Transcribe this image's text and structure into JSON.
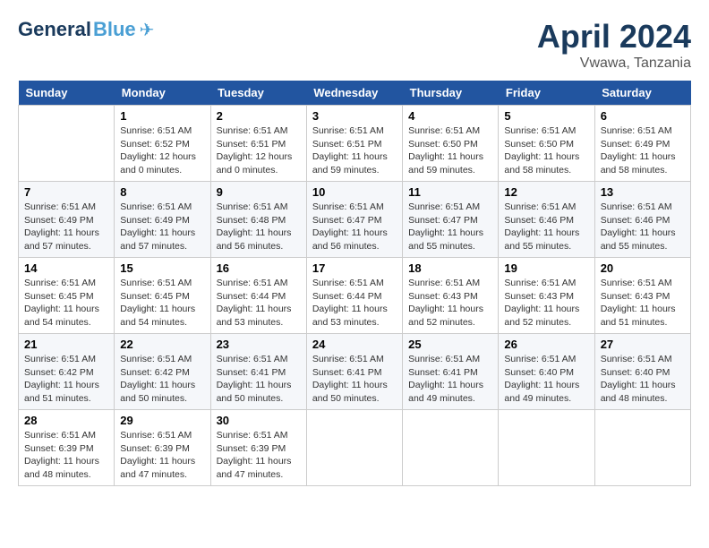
{
  "header": {
    "logo_general": "General",
    "logo_blue": "Blue",
    "month": "April 2024",
    "location": "Vwawa, Tanzania"
  },
  "weekdays": [
    "Sunday",
    "Monday",
    "Tuesday",
    "Wednesday",
    "Thursday",
    "Friday",
    "Saturday"
  ],
  "weeks": [
    [
      {
        "day": "",
        "info": ""
      },
      {
        "day": "1",
        "info": "Sunrise: 6:51 AM\nSunset: 6:52 PM\nDaylight: 12 hours\nand 0 minutes."
      },
      {
        "day": "2",
        "info": "Sunrise: 6:51 AM\nSunset: 6:51 PM\nDaylight: 12 hours\nand 0 minutes."
      },
      {
        "day": "3",
        "info": "Sunrise: 6:51 AM\nSunset: 6:51 PM\nDaylight: 11 hours\nand 59 minutes."
      },
      {
        "day": "4",
        "info": "Sunrise: 6:51 AM\nSunset: 6:50 PM\nDaylight: 11 hours\nand 59 minutes."
      },
      {
        "day": "5",
        "info": "Sunrise: 6:51 AM\nSunset: 6:50 PM\nDaylight: 11 hours\nand 58 minutes."
      },
      {
        "day": "6",
        "info": "Sunrise: 6:51 AM\nSunset: 6:49 PM\nDaylight: 11 hours\nand 58 minutes."
      }
    ],
    [
      {
        "day": "7",
        "info": "Sunrise: 6:51 AM\nSunset: 6:49 PM\nDaylight: 11 hours\nand 57 minutes."
      },
      {
        "day": "8",
        "info": "Sunrise: 6:51 AM\nSunset: 6:49 PM\nDaylight: 11 hours\nand 57 minutes."
      },
      {
        "day": "9",
        "info": "Sunrise: 6:51 AM\nSunset: 6:48 PM\nDaylight: 11 hours\nand 56 minutes."
      },
      {
        "day": "10",
        "info": "Sunrise: 6:51 AM\nSunset: 6:47 PM\nDaylight: 11 hours\nand 56 minutes."
      },
      {
        "day": "11",
        "info": "Sunrise: 6:51 AM\nSunset: 6:47 PM\nDaylight: 11 hours\nand 55 minutes."
      },
      {
        "day": "12",
        "info": "Sunrise: 6:51 AM\nSunset: 6:46 PM\nDaylight: 11 hours\nand 55 minutes."
      },
      {
        "day": "13",
        "info": "Sunrise: 6:51 AM\nSunset: 6:46 PM\nDaylight: 11 hours\nand 55 minutes."
      }
    ],
    [
      {
        "day": "14",
        "info": "Sunrise: 6:51 AM\nSunset: 6:45 PM\nDaylight: 11 hours\nand 54 minutes."
      },
      {
        "day": "15",
        "info": "Sunrise: 6:51 AM\nSunset: 6:45 PM\nDaylight: 11 hours\nand 54 minutes."
      },
      {
        "day": "16",
        "info": "Sunrise: 6:51 AM\nSunset: 6:44 PM\nDaylight: 11 hours\nand 53 minutes."
      },
      {
        "day": "17",
        "info": "Sunrise: 6:51 AM\nSunset: 6:44 PM\nDaylight: 11 hours\nand 53 minutes."
      },
      {
        "day": "18",
        "info": "Sunrise: 6:51 AM\nSunset: 6:43 PM\nDaylight: 11 hours\nand 52 minutes."
      },
      {
        "day": "19",
        "info": "Sunrise: 6:51 AM\nSunset: 6:43 PM\nDaylight: 11 hours\nand 52 minutes."
      },
      {
        "day": "20",
        "info": "Sunrise: 6:51 AM\nSunset: 6:43 PM\nDaylight: 11 hours\nand 51 minutes."
      }
    ],
    [
      {
        "day": "21",
        "info": "Sunrise: 6:51 AM\nSunset: 6:42 PM\nDaylight: 11 hours\nand 51 minutes."
      },
      {
        "day": "22",
        "info": "Sunrise: 6:51 AM\nSunset: 6:42 PM\nDaylight: 11 hours\nand 50 minutes."
      },
      {
        "day": "23",
        "info": "Sunrise: 6:51 AM\nSunset: 6:41 PM\nDaylight: 11 hours\nand 50 minutes."
      },
      {
        "day": "24",
        "info": "Sunrise: 6:51 AM\nSunset: 6:41 PM\nDaylight: 11 hours\nand 50 minutes."
      },
      {
        "day": "25",
        "info": "Sunrise: 6:51 AM\nSunset: 6:41 PM\nDaylight: 11 hours\nand 49 minutes."
      },
      {
        "day": "26",
        "info": "Sunrise: 6:51 AM\nSunset: 6:40 PM\nDaylight: 11 hours\nand 49 minutes."
      },
      {
        "day": "27",
        "info": "Sunrise: 6:51 AM\nSunset: 6:40 PM\nDaylight: 11 hours\nand 48 minutes."
      }
    ],
    [
      {
        "day": "28",
        "info": "Sunrise: 6:51 AM\nSunset: 6:39 PM\nDaylight: 11 hours\nand 48 minutes."
      },
      {
        "day": "29",
        "info": "Sunrise: 6:51 AM\nSunset: 6:39 PM\nDaylight: 11 hours\nand 47 minutes."
      },
      {
        "day": "30",
        "info": "Sunrise: 6:51 AM\nSunset: 6:39 PM\nDaylight: 11 hours\nand 47 minutes."
      },
      {
        "day": "",
        "info": ""
      },
      {
        "day": "",
        "info": ""
      },
      {
        "day": "",
        "info": ""
      },
      {
        "day": "",
        "info": ""
      }
    ]
  ]
}
